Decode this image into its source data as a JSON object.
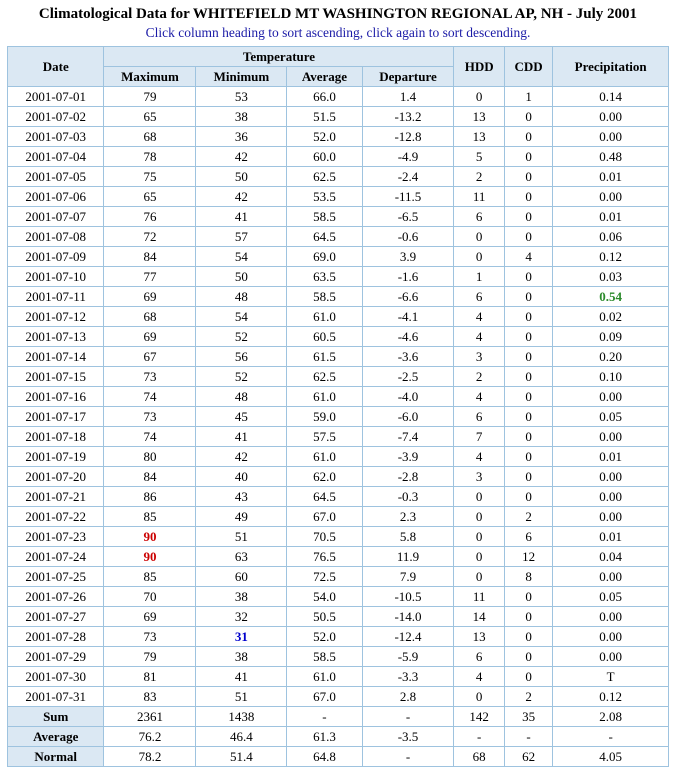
{
  "title": "Climatological Data for WHITEFIELD MT WASHINGTON REGIONAL AP, NH - July 2001",
  "subtitle": "Click column heading to sort ascending, click again to sort descending.",
  "headers": {
    "date": "Date",
    "temperature": "Temperature",
    "maximum": "Maximum",
    "minimum": "Minimum",
    "average": "Average",
    "departure": "Departure",
    "hdd": "HDD",
    "cdd": "CDD",
    "precipitation": "Precipitation"
  },
  "rows": [
    {
      "date": "2001-07-01",
      "max": "79",
      "min": "53",
      "avg": "66.0",
      "dep": "1.4",
      "hdd": "0",
      "cdd": "1",
      "pcp": "0.14"
    },
    {
      "date": "2001-07-02",
      "max": "65",
      "min": "38",
      "avg": "51.5",
      "dep": "-13.2",
      "hdd": "13",
      "cdd": "0",
      "pcp": "0.00"
    },
    {
      "date": "2001-07-03",
      "max": "68",
      "min": "36",
      "avg": "52.0",
      "dep": "-12.8",
      "hdd": "13",
      "cdd": "0",
      "pcp": "0.00"
    },
    {
      "date": "2001-07-04",
      "max": "78",
      "min": "42",
      "avg": "60.0",
      "dep": "-4.9",
      "hdd": "5",
      "cdd": "0",
      "pcp": "0.48"
    },
    {
      "date": "2001-07-05",
      "max": "75",
      "min": "50",
      "avg": "62.5",
      "dep": "-2.4",
      "hdd": "2",
      "cdd": "0",
      "pcp": "0.01"
    },
    {
      "date": "2001-07-06",
      "max": "65",
      "min": "42",
      "avg": "53.5",
      "dep": "-11.5",
      "hdd": "11",
      "cdd": "0",
      "pcp": "0.00"
    },
    {
      "date": "2001-07-07",
      "max": "76",
      "min": "41",
      "avg": "58.5",
      "dep": "-6.5",
      "hdd": "6",
      "cdd": "0",
      "pcp": "0.01"
    },
    {
      "date": "2001-07-08",
      "max": "72",
      "min": "57",
      "avg": "64.5",
      "dep": "-0.6",
      "hdd": "0",
      "cdd": "0",
      "pcp": "0.06"
    },
    {
      "date": "2001-07-09",
      "max": "84",
      "min": "54",
      "avg": "69.0",
      "dep": "3.9",
      "hdd": "0",
      "cdd": "4",
      "pcp": "0.12"
    },
    {
      "date": "2001-07-10",
      "max": "77",
      "min": "50",
      "avg": "63.5",
      "dep": "-1.6",
      "hdd": "1",
      "cdd": "0",
      "pcp": "0.03"
    },
    {
      "date": "2001-07-11",
      "max": "69",
      "min": "48",
      "avg": "58.5",
      "dep": "-6.6",
      "hdd": "6",
      "cdd": "0",
      "pcp": "0.54",
      "pcp_highlight": true
    },
    {
      "date": "2001-07-12",
      "max": "68",
      "min": "54",
      "avg": "61.0",
      "dep": "-4.1",
      "hdd": "4",
      "cdd": "0",
      "pcp": "0.02"
    },
    {
      "date": "2001-07-13",
      "max": "69",
      "min": "52",
      "avg": "60.5",
      "dep": "-4.6",
      "hdd": "4",
      "cdd": "0",
      "pcp": "0.09"
    },
    {
      "date": "2001-07-14",
      "max": "67",
      "min": "56",
      "avg": "61.5",
      "dep": "-3.6",
      "hdd": "3",
      "cdd": "0",
      "pcp": "0.20"
    },
    {
      "date": "2001-07-15",
      "max": "73",
      "min": "52",
      "avg": "62.5",
      "dep": "-2.5",
      "hdd": "2",
      "cdd": "0",
      "pcp": "0.10"
    },
    {
      "date": "2001-07-16",
      "max": "74",
      "min": "48",
      "avg": "61.0",
      "dep": "-4.0",
      "hdd": "4",
      "cdd": "0",
      "pcp": "0.00"
    },
    {
      "date": "2001-07-17",
      "max": "73",
      "min": "45",
      "avg": "59.0",
      "dep": "-6.0",
      "hdd": "6",
      "cdd": "0",
      "pcp": "0.05"
    },
    {
      "date": "2001-07-18",
      "max": "74",
      "min": "41",
      "avg": "57.5",
      "dep": "-7.4",
      "hdd": "7",
      "cdd": "0",
      "pcp": "0.00"
    },
    {
      "date": "2001-07-19",
      "max": "80",
      "min": "42",
      "avg": "61.0",
      "dep": "-3.9",
      "hdd": "4",
      "cdd": "0",
      "pcp": "0.01"
    },
    {
      "date": "2001-07-20",
      "max": "84",
      "min": "40",
      "avg": "62.0",
      "dep": "-2.8",
      "hdd": "3",
      "cdd": "0",
      "pcp": "0.00"
    },
    {
      "date": "2001-07-21",
      "max": "86",
      "min": "43",
      "avg": "64.5",
      "dep": "-0.3",
      "hdd": "0",
      "cdd": "0",
      "pcp": "0.00"
    },
    {
      "date": "2001-07-22",
      "max": "85",
      "min": "49",
      "avg": "67.0",
      "dep": "2.3",
      "hdd": "0",
      "cdd": "2",
      "pcp": "0.00"
    },
    {
      "date": "2001-07-23",
      "max": "90",
      "min": "51",
      "avg": "70.5",
      "dep": "5.8",
      "hdd": "0",
      "cdd": "6",
      "pcp": "0.01",
      "max_highlight": true
    },
    {
      "date": "2001-07-24",
      "max": "90",
      "min": "63",
      "avg": "76.5",
      "dep": "11.9",
      "hdd": "0",
      "cdd": "12",
      "pcp": "0.04",
      "max_highlight": true
    },
    {
      "date": "2001-07-25",
      "max": "85",
      "min": "60",
      "avg": "72.5",
      "dep": "7.9",
      "hdd": "0",
      "cdd": "8",
      "pcp": "0.00"
    },
    {
      "date": "2001-07-26",
      "max": "70",
      "min": "38",
      "avg": "54.0",
      "dep": "-10.5",
      "hdd": "11",
      "cdd": "0",
      "pcp": "0.05"
    },
    {
      "date": "2001-07-27",
      "max": "69",
      "min": "32",
      "avg": "50.5",
      "dep": "-14.0",
      "hdd": "14",
      "cdd": "0",
      "pcp": "0.00"
    },
    {
      "date": "2001-07-28",
      "max": "73",
      "min": "31",
      "avg": "52.0",
      "dep": "-12.4",
      "hdd": "13",
      "cdd": "0",
      "pcp": "0.00",
      "min_highlight": true
    },
    {
      "date": "2001-07-29",
      "max": "79",
      "min": "38",
      "avg": "58.5",
      "dep": "-5.9",
      "hdd": "6",
      "cdd": "0",
      "pcp": "0.00"
    },
    {
      "date": "2001-07-30",
      "max": "81",
      "min": "41",
      "avg": "61.0",
      "dep": "-3.3",
      "hdd": "4",
      "cdd": "0",
      "pcp": "T"
    },
    {
      "date": "2001-07-31",
      "max": "83",
      "min": "51",
      "avg": "67.0",
      "dep": "2.8",
      "hdd": "0",
      "cdd": "2",
      "pcp": "0.12"
    }
  ],
  "footer": [
    {
      "label": "Sum",
      "max": "2361",
      "min": "1438",
      "avg": "-",
      "dep": "-",
      "hdd": "142",
      "cdd": "35",
      "pcp": "2.08"
    },
    {
      "label": "Average",
      "max": "76.2",
      "min": "46.4",
      "avg": "61.3",
      "dep": "-3.5",
      "hdd": "-",
      "cdd": "-",
      "pcp": "-"
    },
    {
      "label": "Normal",
      "max": "78.2",
      "min": "51.4",
      "avg": "64.8",
      "dep": "-",
      "hdd": "68",
      "cdd": "62",
      "pcp": "4.05"
    }
  ],
  "colors": {
    "header_bg": "#dbe8f3",
    "border": "#9ec3df",
    "link_text": "#1a1aa6",
    "max_highlight": "#cc0000",
    "min_highlight": "#0000cc",
    "precip_highlight": "#2b8a2b"
  }
}
